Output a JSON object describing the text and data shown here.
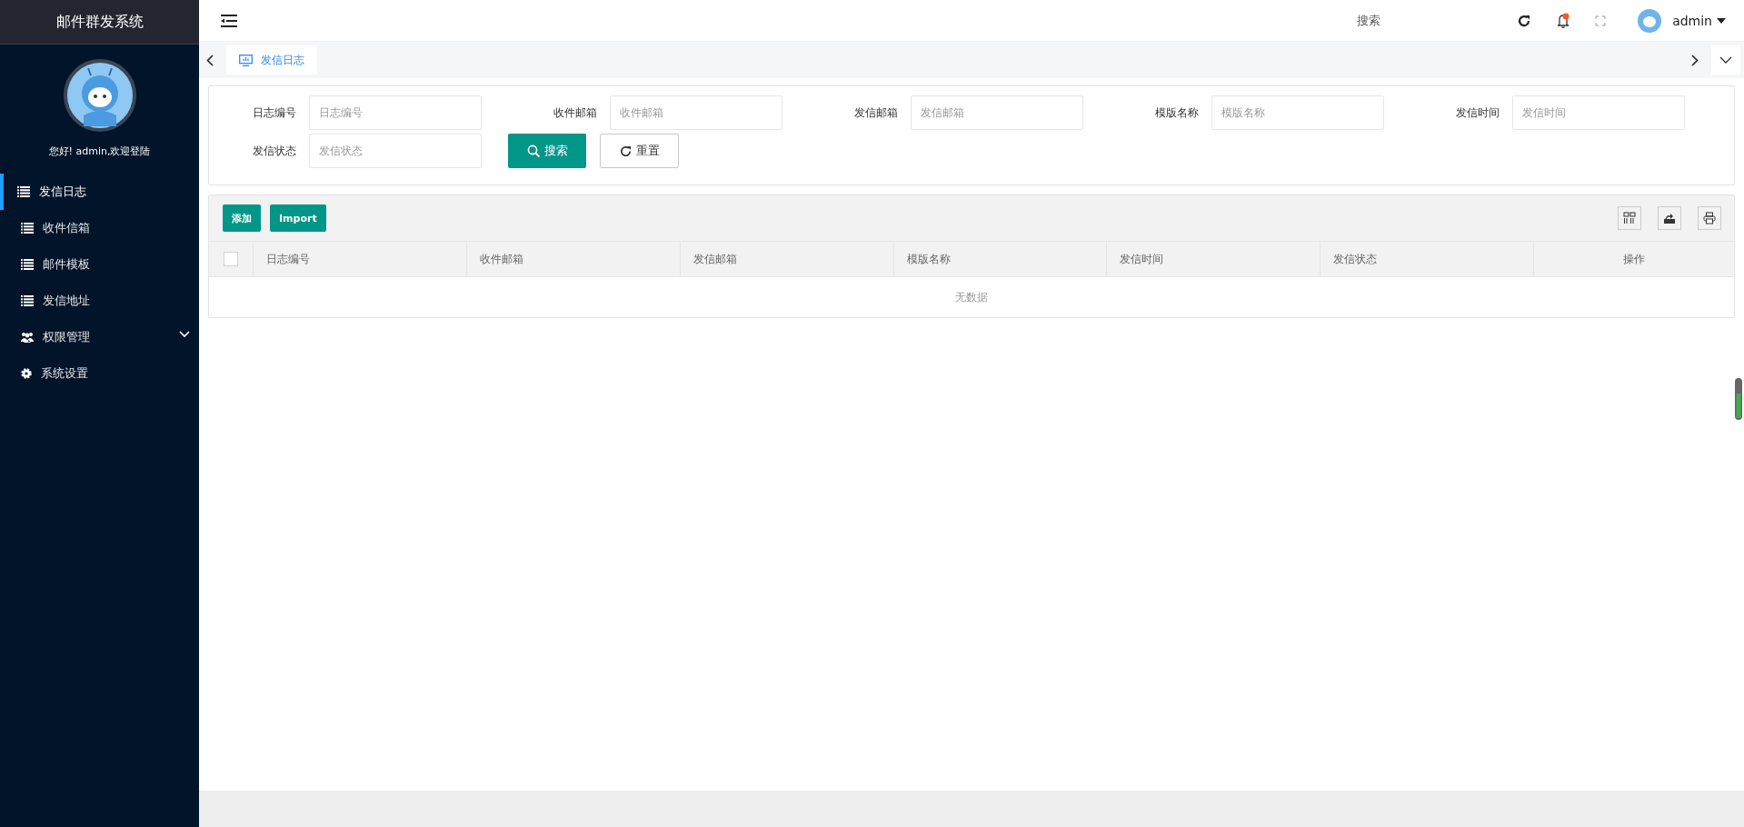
{
  "sidebar": {
    "title": "邮件群发系统",
    "greeting": "您好! admin,欢迎登陆",
    "items": [
      {
        "label": "发信日志",
        "kind": "page",
        "selected": true,
        "expandable": false
      },
      {
        "label": "收件信箱",
        "kind": "page",
        "selected": false,
        "expandable": false
      },
      {
        "label": "邮件模板",
        "kind": "page",
        "selected": false,
        "expandable": false
      },
      {
        "label": "发信地址",
        "kind": "page",
        "selected": false,
        "expandable": false
      },
      {
        "label": "权限管理",
        "kind": "group",
        "selected": false,
        "expandable": true
      },
      {
        "label": "系统设置",
        "kind": "settings",
        "selected": false,
        "expandable": false
      }
    ]
  },
  "header": {
    "search": "搜索",
    "notification": true,
    "user": "admin"
  },
  "tabs": [
    {
      "label": "发信日志",
      "selected": true
    }
  ],
  "filters": [
    {
      "label": "日志编号",
      "placeholder": "日志编号"
    },
    {
      "label": "收件邮箱",
      "placeholder": "收件邮箱"
    },
    {
      "label": "发信邮箱",
      "placeholder": "发信邮箱"
    },
    {
      "label": "模版名称",
      "placeholder": "模版名称"
    },
    {
      "label": "发信时间",
      "placeholder": "发信时间"
    },
    {
      "label": "发信状态",
      "placeholder": "发信状态"
    }
  ],
  "filter_buttons": [
    {
      "label": "搜索",
      "kind": "search"
    },
    {
      "label": "重置",
      "kind": "reset"
    }
  ],
  "toolbar_buttons": [
    "添加",
    "Import"
  ],
  "table": {
    "columns": [
      "日志编号",
      "收件邮箱",
      "发信邮箱",
      "模版名称",
      "发信时间",
      "发信状态",
      "操作"
    ],
    "select_all_checked": false,
    "empty_text": "无数据"
  }
}
